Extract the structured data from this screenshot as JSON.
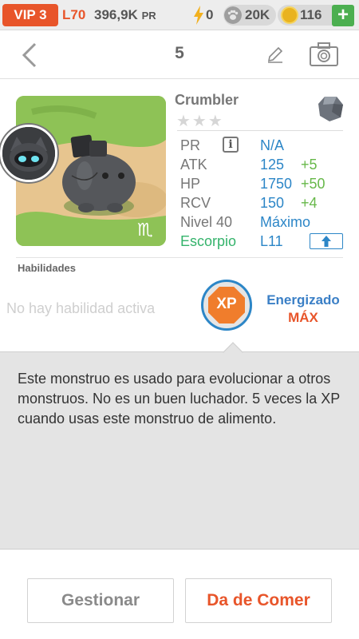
{
  "status": {
    "vip": "VIP 3",
    "level": "L70",
    "pr_value": "396,9K",
    "pr_unit": "PR",
    "energy": "0",
    "paws": "20K",
    "gems": "116",
    "plus": "+"
  },
  "nav": {
    "title": "5"
  },
  "monster": {
    "name": "Crumbler",
    "stars": "★★★",
    "zodiac_glyph": "♏",
    "stats": {
      "pr_label": "PR",
      "pr_info": "i",
      "pr_value": "N/A",
      "atk_label": "ATK",
      "atk_value": "125",
      "atk_bonus": "+5",
      "hp_label": "HP",
      "hp_value": "1750",
      "hp_bonus": "+50",
      "rcv_label": "RCV",
      "rcv_value": "150",
      "rcv_bonus": "+4",
      "level_label": "Nivel 40",
      "level_value": "Máximo",
      "zodiac_label": "Escorpio",
      "zodiac_value": "L11"
    }
  },
  "skills": {
    "heading": "Habilidades",
    "none": "No hay habilidad activa",
    "xp_badge": "XP",
    "energized": "Energizado",
    "max": "MÁX"
  },
  "description": "Este monstruo es usado para evolucionar a otros monstruos. No es un buen luchador. 5 veces la XP cuando usas este monstruo de alimento.",
  "buttons": {
    "manage": "Gestionar",
    "feed": "Da de Comer"
  },
  "colors": {
    "accent": "#e8552a",
    "blue": "#2c86c7",
    "green": "#67b84a",
    "zodiac": "#34b36b"
  }
}
